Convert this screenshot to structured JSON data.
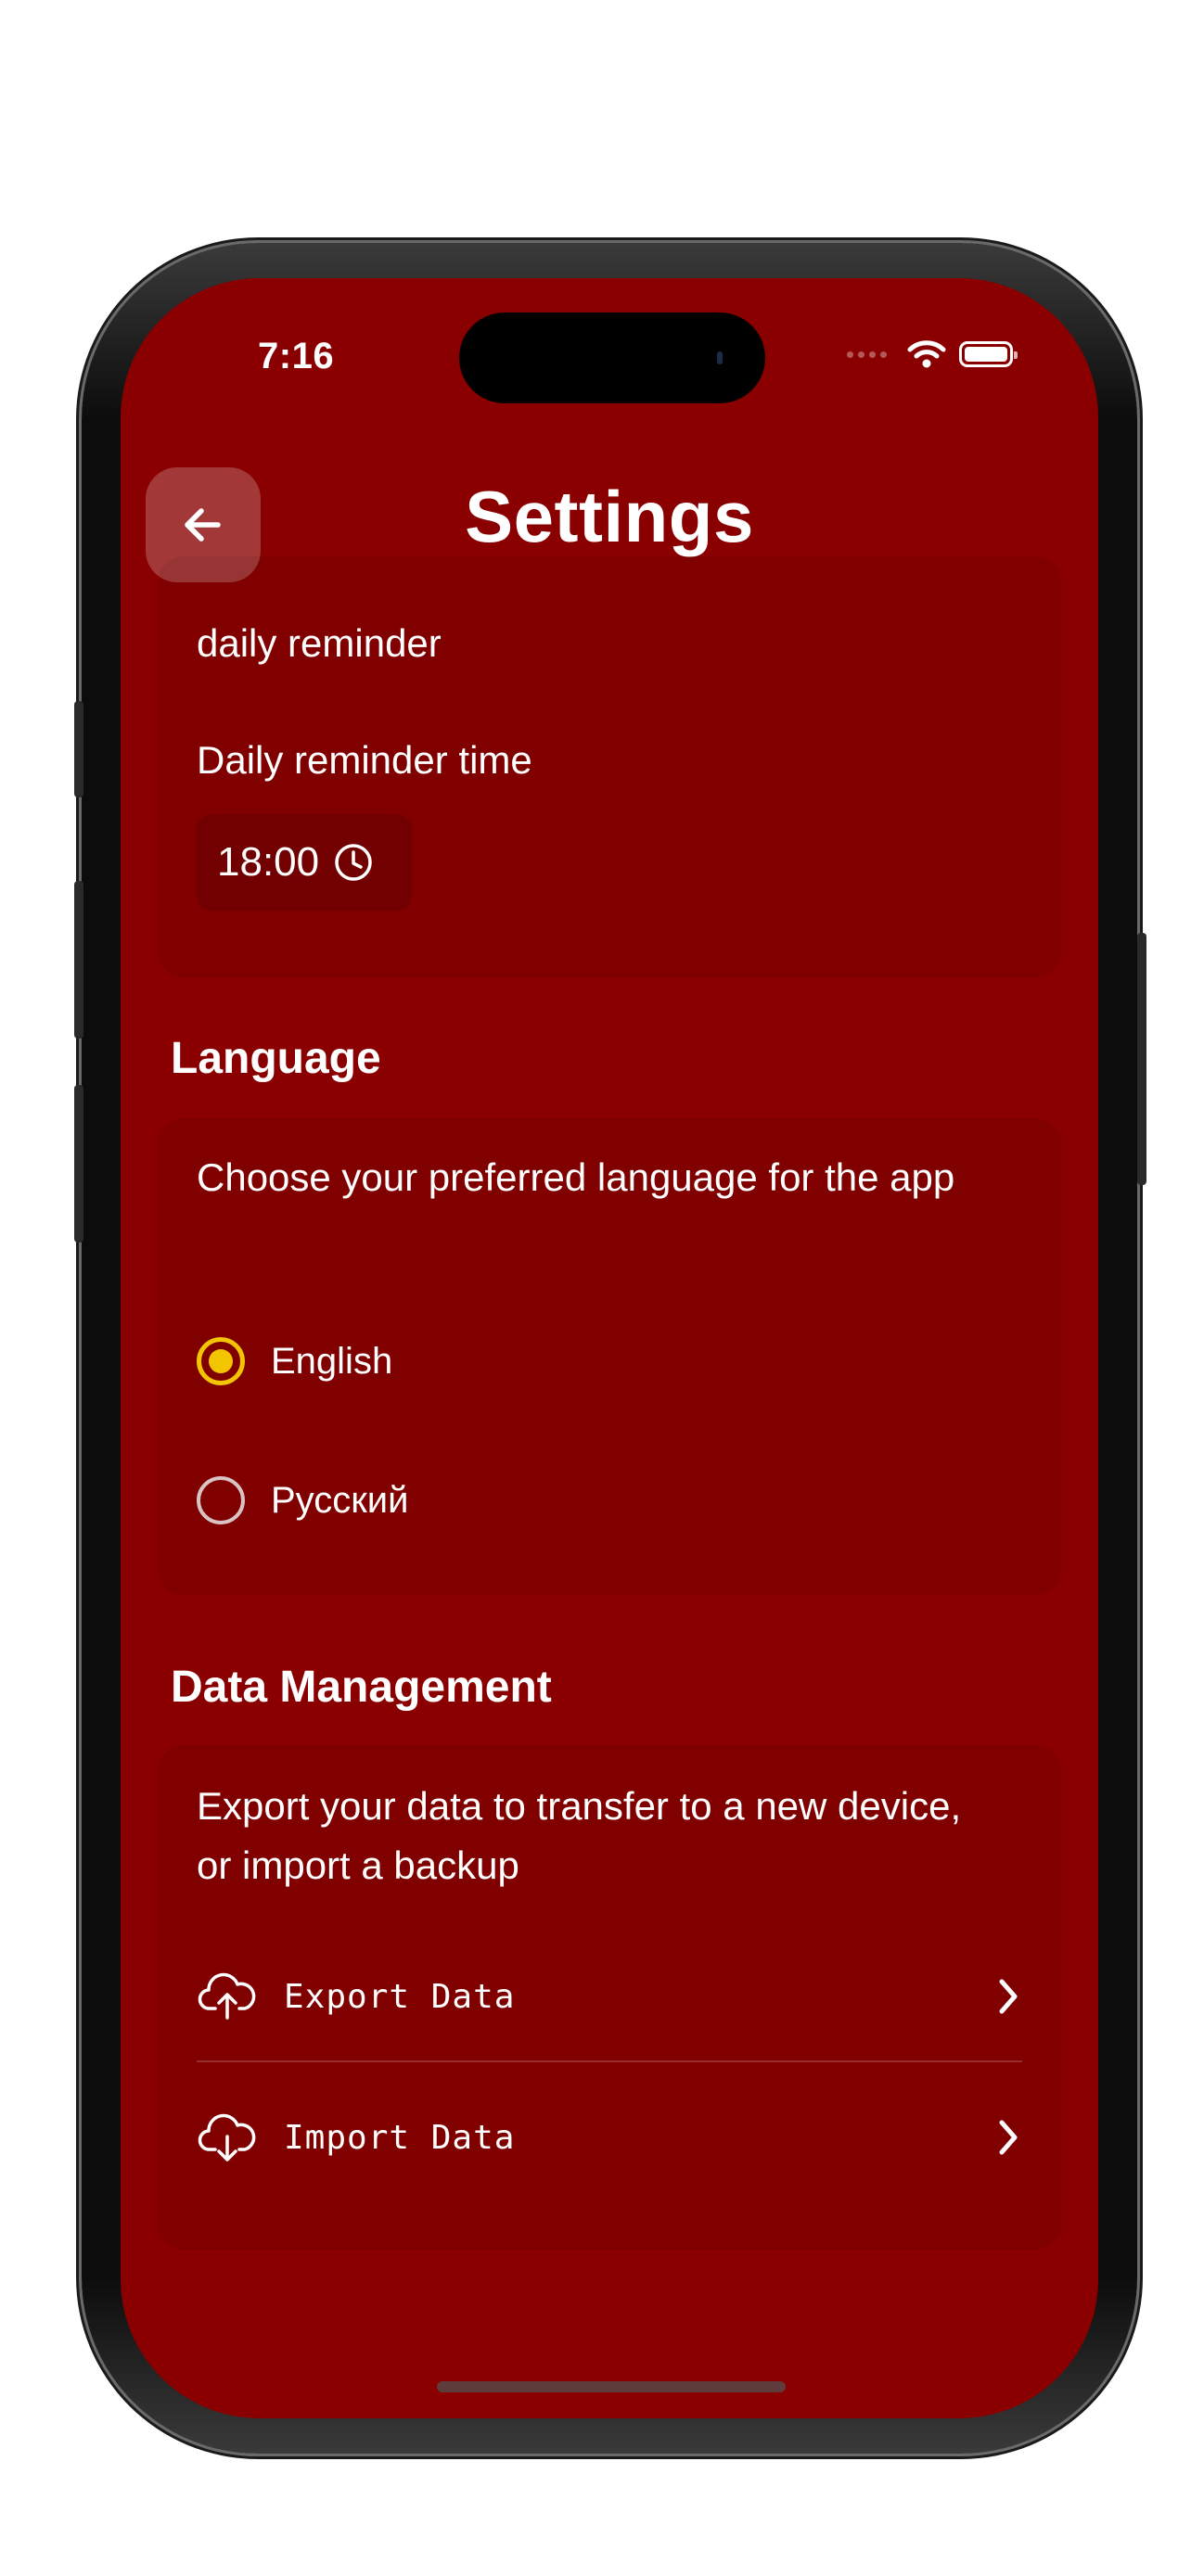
{
  "status_bar": {
    "time": "7:16"
  },
  "header": {
    "title": "Settings",
    "back_icon": "arrow-left-icon"
  },
  "reminder_section": {
    "toggle_label": "daily reminder",
    "time_label": "Daily reminder time",
    "time_value": "18:00",
    "time_icon": "clock-icon"
  },
  "language_section": {
    "title": "Language",
    "description": "Choose your preferred language for the app",
    "options": [
      {
        "label": "English",
        "selected": true
      },
      {
        "label": "Русский",
        "selected": false
      }
    ]
  },
  "data_section": {
    "title": "Data Management",
    "description": "Export your data to transfer to a new device, or import a backup",
    "actions": [
      {
        "label": "Export Data",
        "icon": "cloud-upload-icon"
      },
      {
        "label": "Import Data",
        "icon": "cloud-download-icon"
      }
    ]
  },
  "colors": {
    "background": "#8a0000",
    "accent": "#f3c400",
    "text": "#ffffff"
  }
}
